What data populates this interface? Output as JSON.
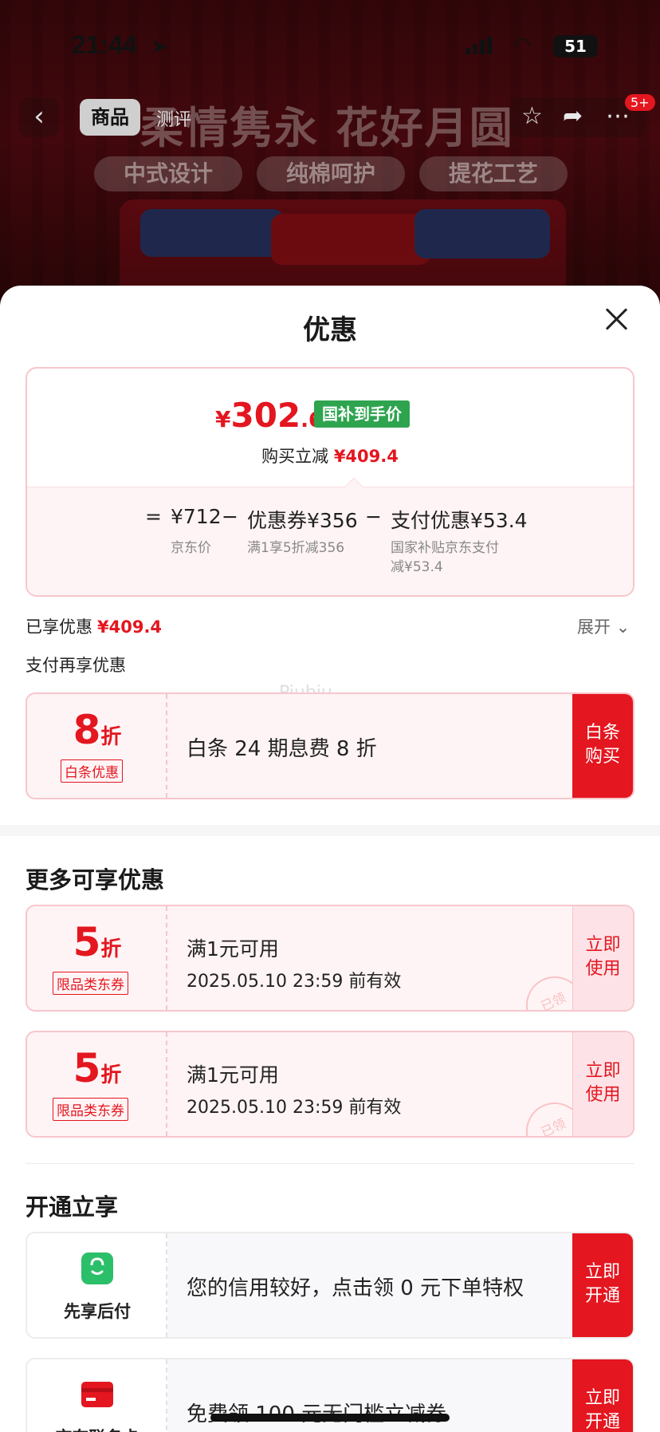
{
  "status_bar": {
    "time": "21:44",
    "battery": "51"
  },
  "product_nav": {
    "tab_active": "商品",
    "tab_other": "测评",
    "headline": "柔情隽永 花好月圆",
    "badge": "5+",
    "features": [
      "中式设计",
      "纯棉呵护",
      "提花工艺"
    ]
  },
  "sheet": {
    "title": "优惠",
    "price": {
      "currency": "¥",
      "integer": "302",
      "decimal": ".6",
      "tag": "国补到手价"
    },
    "cut": {
      "label": "购买立减",
      "amount": "¥409.4"
    },
    "breakdown": {
      "equals": "=",
      "jd_price": "¥712",
      "jd_price_label": "京东价",
      "minus1": "−",
      "coupon": "优惠券¥356",
      "coupon_label": "满1享5折减356",
      "minus2": "−",
      "pay": "支付优惠¥53.4",
      "pay_label_1": "国家补贴京东支付",
      "pay_label_2": "减¥53.4"
    },
    "enjoyed": {
      "label": "已享优惠",
      "amount": "¥409.4",
      "expand": "展开"
    },
    "pay_more_title": "支付再享优惠",
    "watermark": "Piubiu",
    "baitiao": {
      "rate": "8",
      "unit": "折",
      "tag": "白条优惠",
      "desc": "白条 24 期息费 8 折",
      "cta_1": "白条",
      "cta_2": "购买"
    },
    "more_title": "更多可享优惠",
    "coupons": [
      {
        "rate": "5",
        "unit": "折",
        "tag": "限品类东券",
        "line1": "满1元可用",
        "line2": "2025.05.10 23:59 前有效",
        "cta_1": "立即",
        "cta_2": "使用",
        "stamp": "已领"
      },
      {
        "rate": "5",
        "unit": "折",
        "tag": "限品类东券",
        "line1": "满1元可用",
        "line2": "2025.05.10 23:59 前有效",
        "cta_1": "立即",
        "cta_2": "使用",
        "stamp": "已领"
      }
    ],
    "open_title": "开通立享",
    "services": [
      {
        "name": "先享后付",
        "desc": "您的信用较好，点击领 0 元下单特权",
        "cta_1": "立即",
        "cta_2": "开通",
        "icon": "shopping-bag-icon"
      },
      {
        "name": "京东联名卡",
        "desc": "免费领 100 元无门槛立减券",
        "cta_1": "立即",
        "cta_2": "开通",
        "icon": "credit-card-icon"
      }
    ]
  },
  "colors": {
    "accent": "#e4161f",
    "subsidy_green": "#2ea44f"
  }
}
